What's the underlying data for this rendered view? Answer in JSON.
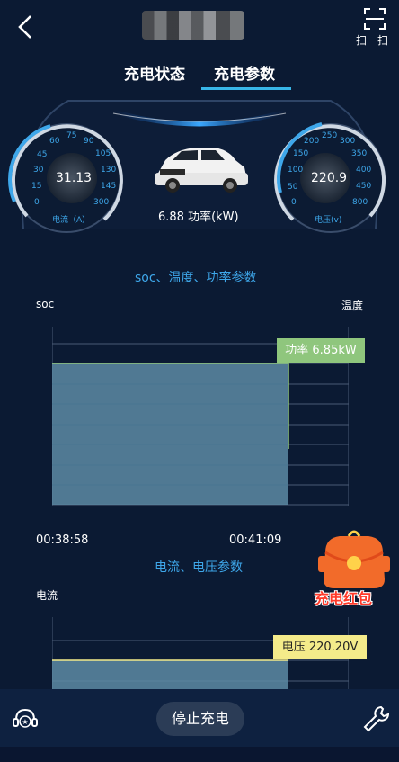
{
  "header": {
    "scan_label": "扫一扫"
  },
  "tabs": [
    {
      "label": "充电状态",
      "active": false
    },
    {
      "label": "充电参数",
      "active": true
    }
  ],
  "gauges": {
    "current": {
      "value": "31.13",
      "label": "电流（A）",
      "ticks": [
        "0",
        "15",
        "30",
        "45",
        "60",
        "75",
        "90",
        "105",
        "130",
        "145",
        "300"
      ]
    },
    "voltage": {
      "value": "220.9",
      "label": "电压(v)",
      "ticks": [
        "0",
        "50",
        "100",
        "150",
        "200",
        "250",
        "300",
        "350",
        "400",
        "450",
        "800"
      ]
    },
    "power_text": "6.88 功率(kW)"
  },
  "chart1": {
    "title": "soc、温度、功率参数",
    "left_axis": "soc",
    "right_axis": "温度",
    "tooltip": "功率 6.85kW",
    "time_start": "00:38:58",
    "time_end": "00:41:09"
  },
  "chart2": {
    "title": "电流、电压参数",
    "left_axis": "电流",
    "tooltip": "电压 220.20V"
  },
  "promo": {
    "label": "充电红包"
  },
  "actions": {
    "stop_label": "停止充电"
  },
  "colors": {
    "accent": "#38b6e8",
    "fill": "#5d8ba5",
    "power_line": "#8fc67d",
    "voltage_line": "#f4eb8a"
  }
}
